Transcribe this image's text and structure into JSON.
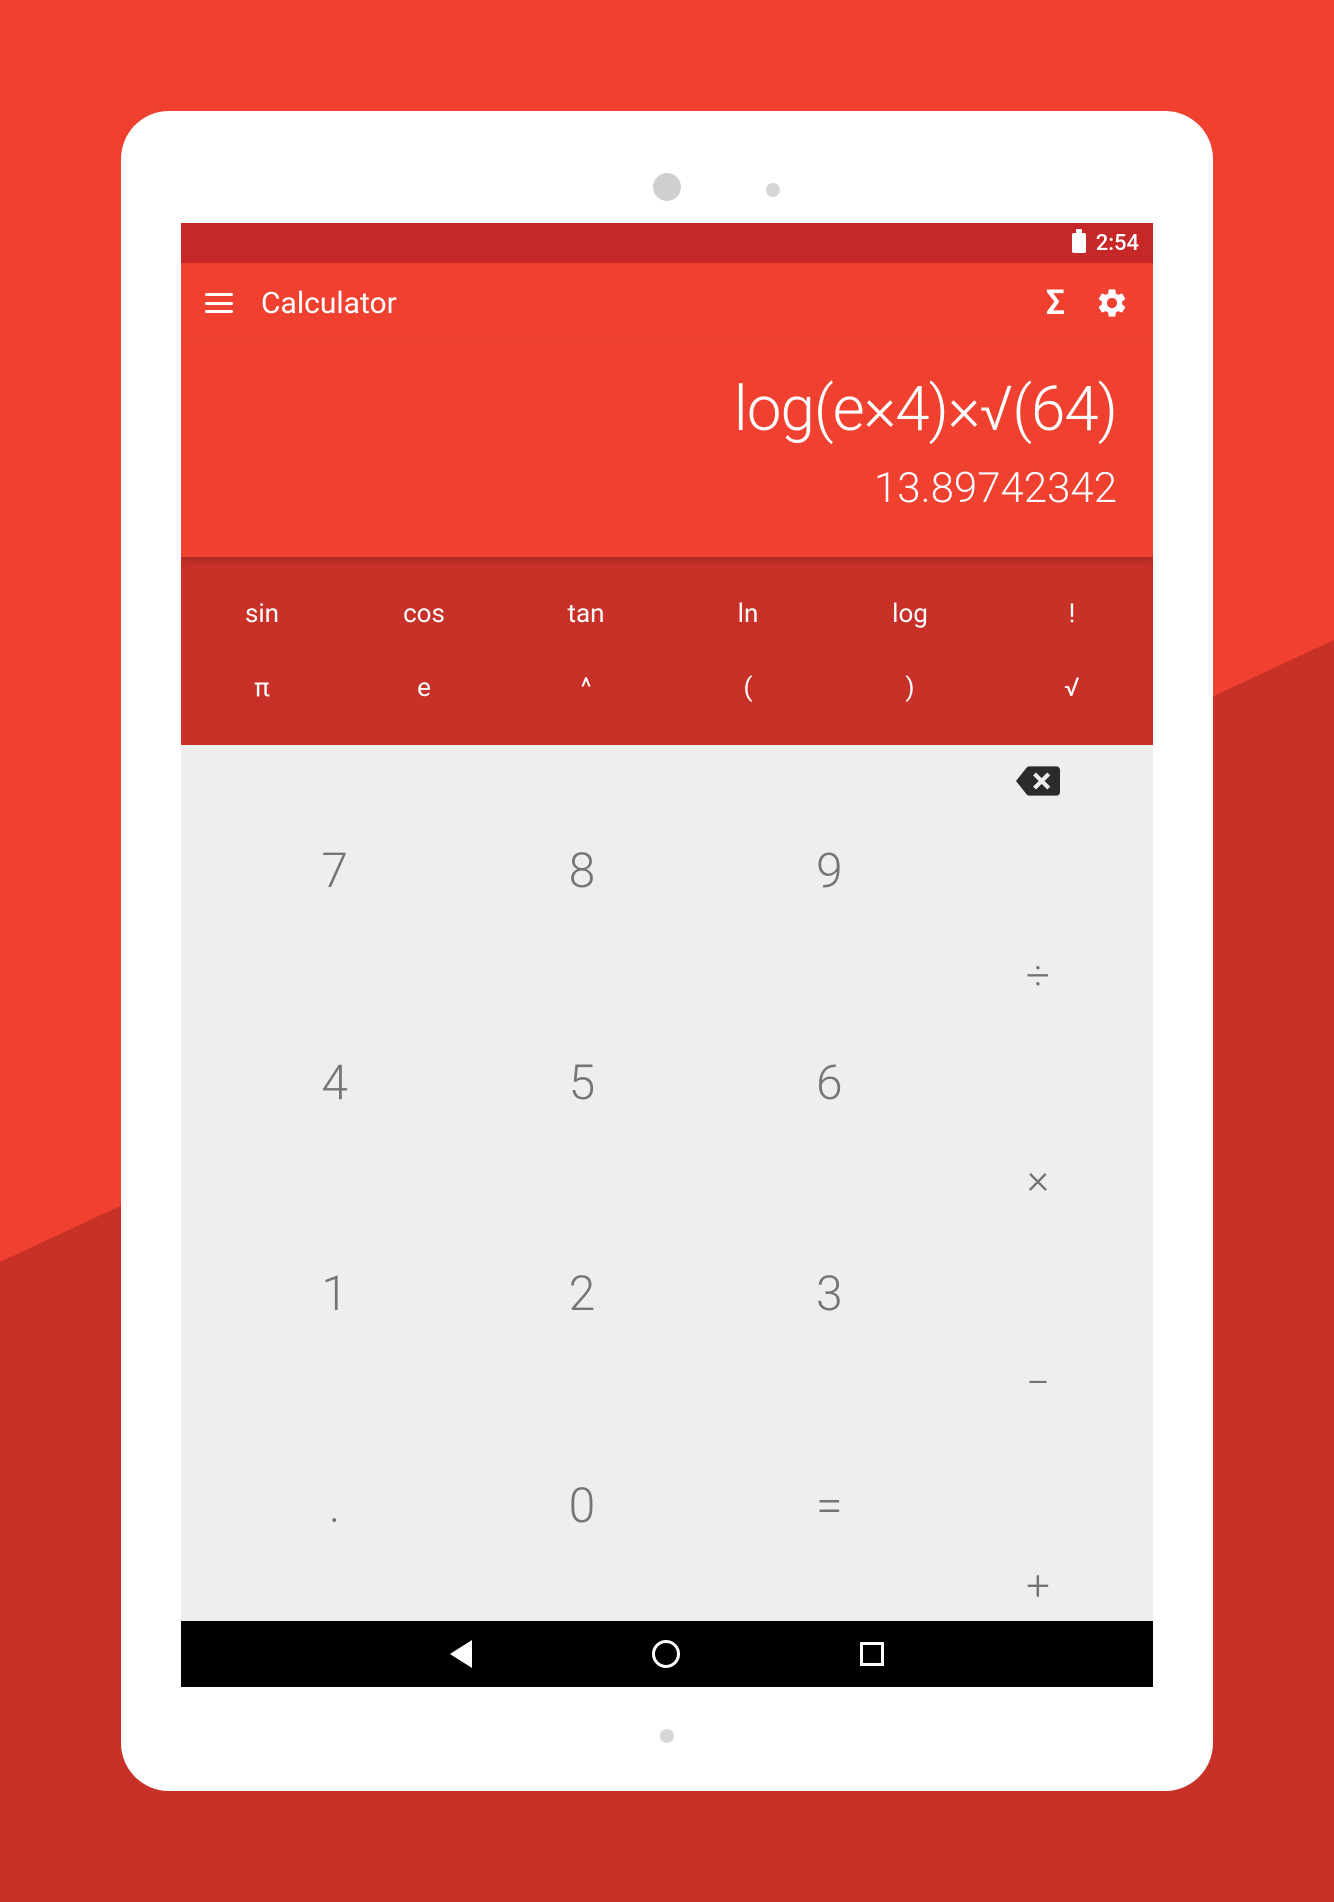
{
  "status_bar": {
    "time": "2:54"
  },
  "app_bar": {
    "title": "Calculator"
  },
  "display": {
    "expression": "log(e×4)×√(64)",
    "result": "13.89742342"
  },
  "sci_keys": {
    "row1": [
      "sin",
      "cos",
      "tan",
      "ln",
      "log",
      "!"
    ],
    "row2": [
      "π",
      "e",
      "^",
      "(",
      ")",
      "√"
    ]
  },
  "num_keys": {
    "row1": [
      "7",
      "8",
      "9"
    ],
    "row2": [
      "4",
      "5",
      "6"
    ],
    "row3": [
      "1",
      "2",
      "3"
    ],
    "row4": [
      ".",
      "0",
      "="
    ]
  },
  "op_keys": [
    "÷",
    "×",
    "−",
    "+"
  ]
}
